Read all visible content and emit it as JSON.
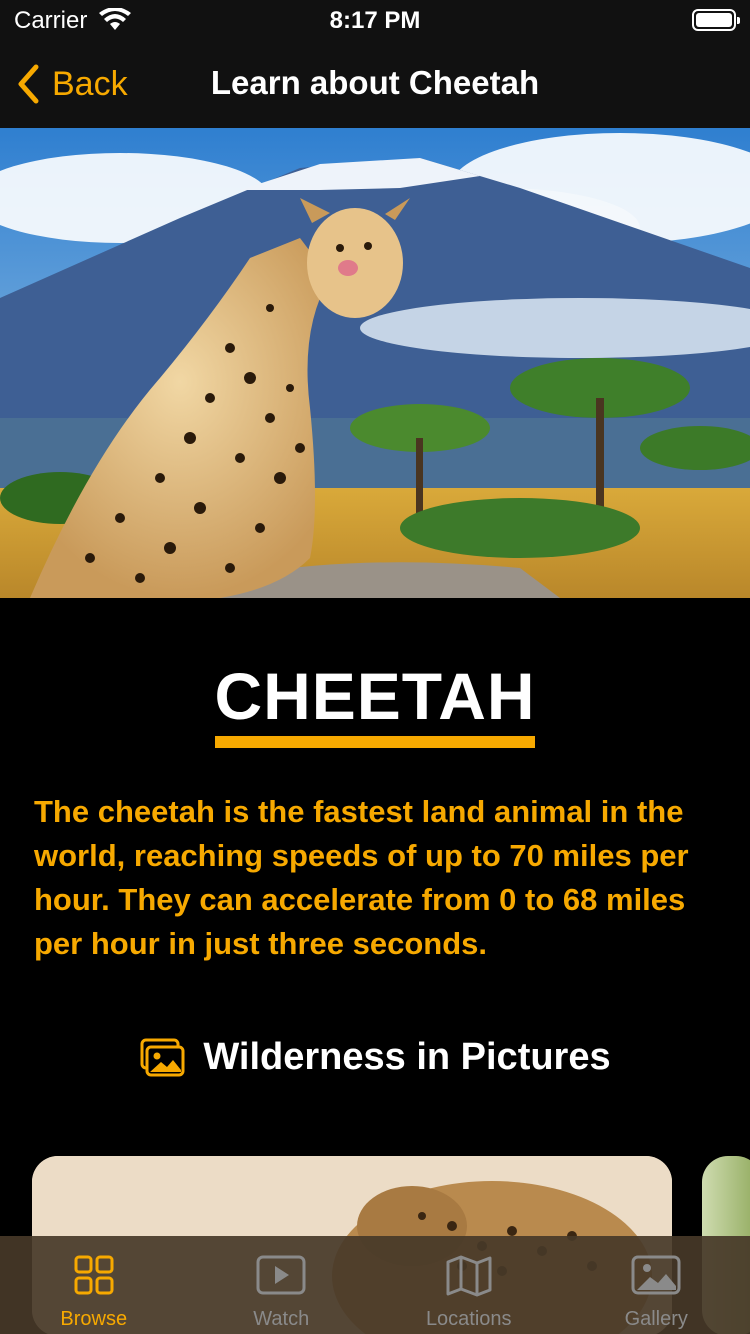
{
  "status_bar": {
    "carrier": "Carrier",
    "time": "8:17 PM"
  },
  "nav": {
    "back_label": "Back",
    "title": "Learn about Cheetah"
  },
  "animal": {
    "name": "CHEETAH",
    "description": "The cheetah is the fastest land animal in the world, reaching speeds of up to 70 miles per hour. They can accelerate from 0 to 68 miles per hour in just three seconds."
  },
  "section": {
    "title": "Wilderness in Pictures",
    "icon": "photos-icon"
  },
  "tab_bar": {
    "tabs": [
      {
        "label": "Browse",
        "icon": "grid-icon",
        "active": true
      },
      {
        "label": "Watch",
        "icon": "play-icon",
        "active": false
      },
      {
        "label": "Locations",
        "icon": "map-icon",
        "active": false
      },
      {
        "label": "Gallery",
        "icon": "photo-icon",
        "active": false
      }
    ]
  },
  "colors": {
    "accent": "#f7a900",
    "background": "#000000",
    "inactive": "#8a8a8a"
  }
}
